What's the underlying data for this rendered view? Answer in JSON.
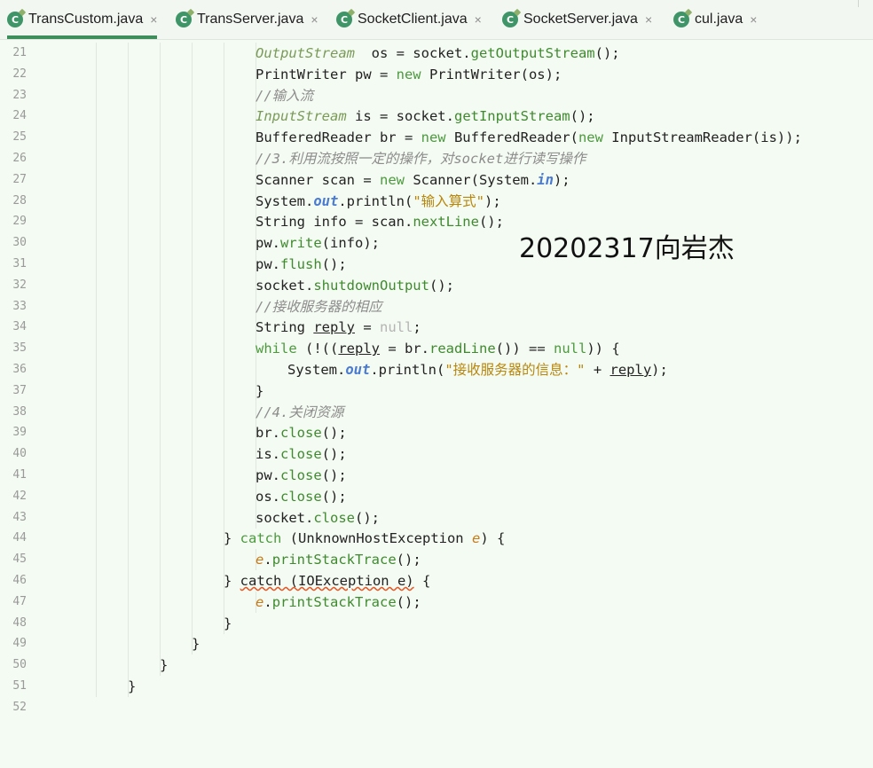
{
  "tabs": [
    {
      "label": "TransCustom.java",
      "active": true
    },
    {
      "label": "TransServer.java",
      "active": false
    },
    {
      "label": "SocketClient.java",
      "active": false
    },
    {
      "label": "SocketServer.java",
      "active": false
    },
    {
      "label": "cul.java",
      "active": false
    }
  ],
  "tab_icon_letter": "C",
  "close_glyph": "×",
  "watermark": "20202317向岩杰",
  "lines": [
    {
      "n": "21",
      "indent": 7,
      "seg": [
        [
          "type",
          "OutputStream"
        ],
        [
          "",
          "  os = socket."
        ],
        [
          "fn",
          "getOutputStream"
        ],
        [
          "",
          "();"
        ]
      ]
    },
    {
      "n": "22",
      "indent": 7,
      "seg": [
        [
          "",
          "PrintWriter pw = "
        ],
        [
          "kw",
          "new"
        ],
        [
          "",
          " PrintWriter(os);"
        ]
      ]
    },
    {
      "n": "23",
      "indent": 7,
      "seg": [
        [
          "cmt",
          "//输入流"
        ]
      ]
    },
    {
      "n": "24",
      "indent": 7,
      "seg": [
        [
          "type",
          "InputStream"
        ],
        [
          "",
          " is = socket."
        ],
        [
          "fn",
          "getInputStream"
        ],
        [
          "",
          "();"
        ]
      ]
    },
    {
      "n": "25",
      "indent": 7,
      "seg": [
        [
          "",
          "BufferedReader br = "
        ],
        [
          "kw",
          "new"
        ],
        [
          "",
          " BufferedReader("
        ],
        [
          "kw",
          "new"
        ],
        [
          "",
          " InputStreamReader(is));"
        ]
      ]
    },
    {
      "n": "26",
      "indent": 7,
      "seg": [
        [
          "cmt",
          "//3.利用流按照一定的操作，对socket进行读写操作"
        ]
      ]
    },
    {
      "n": "27",
      "indent": 7,
      "seg": [
        [
          "",
          "Scanner scan = "
        ],
        [
          "kw",
          "new"
        ],
        [
          "",
          " Scanner(System."
        ],
        [
          "static",
          "in"
        ],
        [
          "",
          ");"
        ]
      ]
    },
    {
      "n": "28",
      "indent": 7,
      "seg": [
        [
          "",
          "System."
        ],
        [
          "static",
          "out"
        ],
        [
          "",
          ".println("
        ],
        [
          "str",
          "\"输入算式\""
        ],
        [
          "",
          ");"
        ]
      ]
    },
    {
      "n": "29",
      "indent": 7,
      "seg": [
        [
          "",
          "String info = scan."
        ],
        [
          "fn",
          "nextLine"
        ],
        [
          "",
          "();"
        ]
      ]
    },
    {
      "n": "30",
      "indent": 7,
      "seg": [
        [
          "",
          "pw."
        ],
        [
          "fn",
          "write"
        ],
        [
          "",
          "(info);"
        ]
      ]
    },
    {
      "n": "31",
      "indent": 7,
      "seg": [
        [
          "",
          "pw."
        ],
        [
          "fn",
          "flush"
        ],
        [
          "",
          "();"
        ]
      ]
    },
    {
      "n": "32",
      "indent": 7,
      "seg": [
        [
          "",
          "socket."
        ],
        [
          "fn",
          "shutdownOutput"
        ],
        [
          "",
          "();"
        ]
      ]
    },
    {
      "n": "33",
      "indent": 7,
      "seg": [
        [
          "cmt",
          "//接收服务器的相应"
        ]
      ]
    },
    {
      "n": "34",
      "indent": 7,
      "seg": [
        [
          "",
          "String "
        ],
        [
          "uline",
          "reply"
        ],
        [
          "",
          " = "
        ],
        [
          "nul",
          "null"
        ],
        [
          "",
          ";"
        ]
      ]
    },
    {
      "n": "35",
      "indent": 7,
      "seg": [
        [
          "kw",
          "while"
        ],
        [
          "",
          " (!(("
        ],
        [
          "uline",
          "reply"
        ],
        [
          "",
          " = br."
        ],
        [
          "fn",
          "readLine"
        ],
        [
          "",
          "()) == "
        ],
        [
          "kw",
          "null"
        ],
        [
          "",
          ")) {"
        ]
      ]
    },
    {
      "n": "36",
      "indent": 8,
      "seg": [
        [
          "",
          "System."
        ],
        [
          "static",
          "out"
        ],
        [
          "",
          ".println("
        ],
        [
          "str",
          "\"接收服务器的信息：\""
        ],
        [
          "",
          " + "
        ],
        [
          "uline",
          "reply"
        ],
        [
          "",
          ");"
        ]
      ]
    },
    {
      "n": "37",
      "indent": 7,
      "seg": [
        [
          "",
          "}"
        ]
      ]
    },
    {
      "n": "38",
      "indent": 7,
      "seg": [
        [
          "cmt",
          "//4.关闭资源"
        ]
      ]
    },
    {
      "n": "39",
      "indent": 7,
      "seg": [
        [
          "",
          "br."
        ],
        [
          "fn",
          "close"
        ],
        [
          "",
          "();"
        ]
      ]
    },
    {
      "n": "40",
      "indent": 7,
      "seg": [
        [
          "",
          "is."
        ],
        [
          "fn",
          "close"
        ],
        [
          "",
          "();"
        ]
      ]
    },
    {
      "n": "41",
      "indent": 7,
      "seg": [
        [
          "",
          "pw."
        ],
        [
          "fn",
          "close"
        ],
        [
          "",
          "();"
        ]
      ]
    },
    {
      "n": "42",
      "indent": 7,
      "seg": [
        [
          "",
          "os."
        ],
        [
          "fn",
          "close"
        ],
        [
          "",
          "();"
        ]
      ]
    },
    {
      "n": "43",
      "indent": 7,
      "seg": [
        [
          "",
          "socket."
        ],
        [
          "fn",
          "close"
        ],
        [
          "",
          "();"
        ]
      ]
    },
    {
      "n": "44",
      "indent": 6,
      "seg": [
        [
          "",
          "} "
        ],
        [
          "kw",
          "catch"
        ],
        [
          "",
          " (UnknownHostException "
        ],
        [
          "param",
          "e"
        ],
        [
          "",
          ") {"
        ]
      ]
    },
    {
      "n": "45",
      "indent": 7,
      "seg": [
        [
          "param",
          "e"
        ],
        [
          "",
          "."
        ],
        [
          "fn",
          "printStackTrace"
        ],
        [
          "",
          "();"
        ]
      ]
    },
    {
      "n": "46",
      "indent": 6,
      "seg": [
        [
          "",
          "} "
        ],
        [
          "warn",
          "catch (IOException e)"
        ],
        [
          "",
          " {"
        ]
      ]
    },
    {
      "n": "47",
      "indent": 7,
      "seg": [
        [
          "param",
          "e"
        ],
        [
          "",
          "."
        ],
        [
          "fn",
          "printStackTrace"
        ],
        [
          "",
          "();"
        ]
      ]
    },
    {
      "n": "48",
      "indent": 6,
      "seg": [
        [
          "",
          "}"
        ]
      ]
    },
    {
      "n": "49",
      "indent": 5,
      "seg": [
        [
          "",
          "}"
        ]
      ]
    },
    {
      "n": "50",
      "indent": 4,
      "seg": [
        [
          "",
          "}"
        ]
      ]
    },
    {
      "n": "51",
      "indent": 3,
      "seg": [
        [
          "",
          "}"
        ]
      ]
    },
    {
      "n": "52",
      "indent": 0,
      "seg": []
    }
  ]
}
